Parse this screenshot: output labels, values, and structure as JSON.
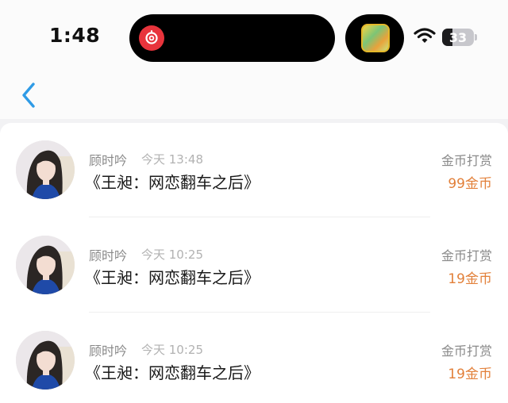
{
  "status_bar": {
    "time": "1:48",
    "battery": "33",
    "battery_level": 0.33
  },
  "nav": {
    "back_icon": "chevron-left-icon",
    "accent_color": "#2f9be6"
  },
  "rewards": [
    {
      "username": "顾时吟",
      "timestamp": "今天 13:48",
      "title": "《王昶：网恋翻车之后》",
      "label": "金币打赏",
      "amount": "99金币"
    },
    {
      "username": "顾时吟",
      "timestamp": "今天 10:25",
      "title": "《王昶：网恋翻车之后》",
      "label": "金币打赏",
      "amount": "19金币"
    },
    {
      "username": "顾时吟",
      "timestamp": "今天 10:25",
      "title": "《王昶：网恋翻车之后》",
      "label": "金币打赏",
      "amount": "19金币"
    }
  ],
  "colors": {
    "amount": "#e2803a",
    "secondary_text": "#8a8a8a",
    "primary_text": "#1a1a1a"
  }
}
